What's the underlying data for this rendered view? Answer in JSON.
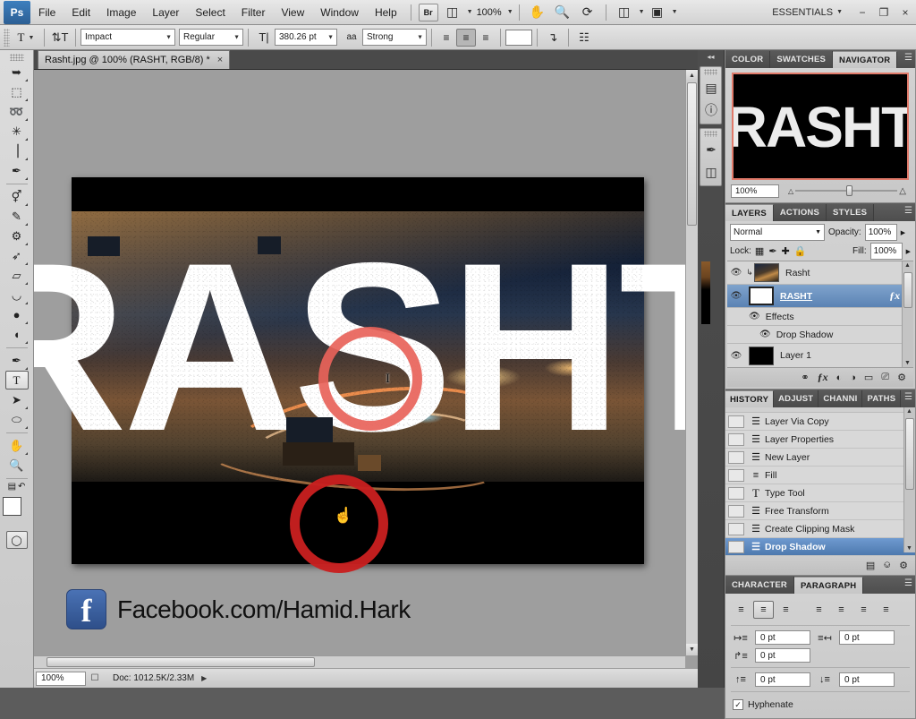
{
  "app": {
    "logo": "Ps",
    "workspace": "ESSENTIALS",
    "zoom_level": "100%"
  },
  "menubar": {
    "items": [
      "File",
      "Edit",
      "Image",
      "Layer",
      "Select",
      "Filter",
      "View",
      "Window",
      "Help"
    ],
    "bridge_label": "Br",
    "window_buttons": [
      "−",
      "❐",
      "×"
    ]
  },
  "options_bar": {
    "tool": "T",
    "font_family": "Impact",
    "font_style": "Regular",
    "font_size": "380.26 pt",
    "antialias_label": "aa",
    "antialias_value": "Strong",
    "color_swatch": "#ffffff",
    "align_active_index": 1
  },
  "document_tab": {
    "title": "Rasht.jpg @ 100% (RASHT, RGB/8) *",
    "close": "×"
  },
  "toolbar": {
    "tools": [
      {
        "name": "move-tool",
        "glyph": "✥"
      },
      {
        "name": "marquee-tool",
        "glyph": "⬚"
      },
      {
        "name": "lasso-tool",
        "glyph": "➿"
      },
      {
        "name": "magic-wand-tool",
        "glyph": "✳"
      },
      {
        "name": "crop-tool",
        "glyph": "⌗"
      },
      {
        "name": "eyedropper-tool",
        "glyph": "✒"
      },
      {
        "name": "healing-brush-tool",
        "glyph": "⚕"
      },
      {
        "name": "brush-tool",
        "glyph": "✎"
      },
      {
        "name": "clone-stamp-tool",
        "glyph": "⚑"
      },
      {
        "name": "history-brush-tool",
        "glyph": "➦"
      },
      {
        "name": "eraser-tool",
        "glyph": "▱"
      },
      {
        "name": "gradient-tool",
        "glyph": "◩"
      },
      {
        "name": "blur-tool",
        "glyph": "●"
      },
      {
        "name": "dodge-tool",
        "glyph": "◖"
      },
      {
        "name": "pen-tool",
        "glyph": "✒"
      },
      {
        "name": "type-tool",
        "glyph": "T"
      },
      {
        "name": "path-selection-tool",
        "glyph": "➤"
      },
      {
        "name": "shape-tool",
        "glyph": "⬭"
      },
      {
        "name": "hand-tool",
        "glyph": "✋"
      },
      {
        "name": "zoom-tool",
        "glyph": "⚲"
      }
    ],
    "active_tool": "type-tool",
    "foreground_color": "#ffffff",
    "background_color": "#000000"
  },
  "canvas": {
    "artwork_text": "RASHT",
    "facebook_text": "Facebook.com/Hamid.Hark",
    "facebook_icon": "f",
    "annotations": [
      {
        "name": "annotation-circle-upper",
        "color": "#e8635a"
      },
      {
        "name": "annotation-circle-lower",
        "color": "#c81f1f"
      }
    ]
  },
  "status_bar": {
    "zoom": "100%",
    "doc_info": "Doc: 1012.5K/2.33M"
  },
  "mini_dock": {
    "icons": [
      {
        "name": "histogram-icon",
        "glyph": "▤"
      },
      {
        "name": "info-icon",
        "glyph": "ⓘ"
      },
      {
        "name": "tool-presets-icon",
        "glyph": "✒"
      },
      {
        "name": "adjustments-icon",
        "glyph": "◧"
      }
    ]
  },
  "navigator_panel": {
    "tabs": [
      "COLOR",
      "SWATCHES",
      "NAVIGATOR"
    ],
    "active_tab": "NAVIGATOR",
    "thumbnail_text": "RASHT",
    "zoom_value": "100%"
  },
  "layers_panel": {
    "tabs": [
      "LAYERS",
      "ACTIONS",
      "STYLES"
    ],
    "active_tab": "LAYERS",
    "blend_mode": "Normal",
    "opacity_label": "Opacity:",
    "opacity_value": "100%",
    "lock_label": "Lock:",
    "fill_label": "Fill:",
    "fill_value": "100%",
    "layers": [
      {
        "name": "Rasht",
        "type": "photo",
        "thumb": "",
        "visible": true,
        "clipped": true,
        "selected": false
      },
      {
        "name": "RASHT",
        "type": "text",
        "thumb": "T",
        "visible": true,
        "clipped": false,
        "selected": true,
        "fx": "ƒx"
      },
      {
        "name": "Layer 1",
        "type": "solid",
        "thumb": "",
        "visible": true,
        "clipped": false,
        "selected": false
      }
    ],
    "effects_label": "Effects",
    "drop_shadow_label": "Drop Shadow",
    "footer_icons": [
      {
        "name": "link-layers-icon",
        "glyph": "⚭"
      },
      {
        "name": "layer-style-icon",
        "glyph": "ƒx"
      },
      {
        "name": "layer-mask-icon",
        "glyph": "◐"
      },
      {
        "name": "adjustment-layer-icon",
        "glyph": "◑"
      },
      {
        "name": "new-group-icon",
        "glyph": "▭"
      },
      {
        "name": "new-layer-icon",
        "glyph": "❐"
      },
      {
        "name": "delete-layer-icon",
        "glyph": "Ὕ1"
      }
    ]
  },
  "history_panel": {
    "tabs": [
      "HISTORY",
      "ADJUSTMENTS",
      "CHANNELS",
      "PATHS"
    ],
    "tabs_short": [
      "HISTORY",
      "ADJUST",
      "CHANNI",
      "PATHS"
    ],
    "active_tab": "HISTORY",
    "items": [
      {
        "label": "Layer Via Copy",
        "icon": "☰",
        "selected": false
      },
      {
        "label": "Layer Properties",
        "icon": "☰",
        "selected": false
      },
      {
        "label": "New Layer",
        "icon": "☰",
        "selected": false
      },
      {
        "label": "Fill",
        "icon": "≡",
        "selected": false
      },
      {
        "label": "Type Tool",
        "icon": "T",
        "selected": false
      },
      {
        "label": "Free Transform",
        "icon": "☰",
        "selected": false
      },
      {
        "label": "Create Clipping Mask",
        "icon": "☰",
        "selected": false
      },
      {
        "label": "Drop Shadow",
        "icon": "☰",
        "selected": true
      }
    ],
    "footer_icons": [
      {
        "name": "new-document-from-state-icon",
        "glyph": "▤"
      },
      {
        "name": "new-snapshot-icon",
        "glyph": "⎙"
      },
      {
        "name": "delete-state-icon",
        "glyph": "Ὕ1"
      }
    ]
  },
  "paragraph_panel": {
    "tabs": [
      "CHARACTER",
      "PARAGRAPH"
    ],
    "active_tab": "PARAGRAPH",
    "align_buttons": [
      {
        "name": "align-left",
        "glyph": "≡",
        "active": false
      },
      {
        "name": "align-center",
        "glyph": "≡",
        "active": true
      },
      {
        "name": "align-right",
        "glyph": "≡",
        "active": false
      },
      {
        "name": "justify-last-left",
        "glyph": "≡",
        "active": false
      },
      {
        "name": "justify-last-center",
        "glyph": "≡",
        "active": false
      },
      {
        "name": "justify-last-right",
        "glyph": "≡",
        "active": false
      },
      {
        "name": "justify-all",
        "glyph": "≡",
        "active": false
      }
    ],
    "indent_left": "0 pt",
    "indent_right": "0 pt",
    "indent_first_line": "0 pt",
    "space_before": "0 pt",
    "space_after": "0 pt",
    "hyphenate_label": "Hyphenate",
    "hyphenate_checked": true,
    "check_glyph": "✓"
  }
}
